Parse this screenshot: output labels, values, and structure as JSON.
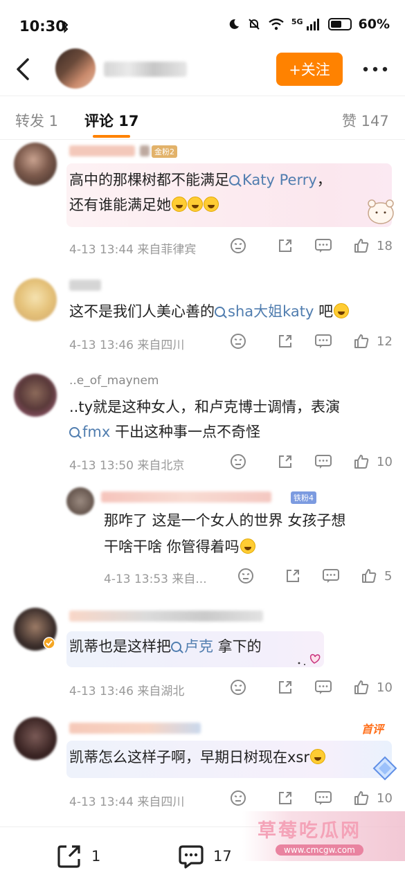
{
  "status": {
    "time": "10:30",
    "battery": "60%",
    "battery_level": 0.6,
    "signal": "5G"
  },
  "header": {
    "follow_label": "+关注"
  },
  "tabs": {
    "repost": "转发 1",
    "comment": "评论 17",
    "like": "赞 147"
  },
  "comments": [
    {
      "badge": "金粉2",
      "text_line1_before": "高中的那棵树都不能满足",
      "topic": "Katy Perry",
      "text_line1_after": "，",
      "text_line2": "还有谁能满足她",
      "meta": "4-13 13:44  来自菲律宾",
      "likes": "18"
    },
    {
      "text_before": "这不是我们人美心善的",
      "topic": "sha大姐katy",
      "text_after": " 吧",
      "meta": "4-13 13:46  来自四川",
      "likes": "12"
    },
    {
      "name_visible": "..e_of_maynem",
      "text_line1": "..ty就是这种女人，和卢克博士调情，表演",
      "topic": "fmx",
      "text_line2_after": " 干出这种事一点不奇怪",
      "meta": "4-13 13:50  来自北京",
      "likes": "10"
    },
    {
      "badge": "铁粉4",
      "text_line1": "那咋了 这是一个女人的世界 女孩子想",
      "text_line2": "干啥干啥 你管得着吗",
      "meta": "4-13 13:53  来自...",
      "likes": "5"
    },
    {
      "text_before": "凯蒂也是这样把",
      "topic": "卢克",
      "text_after": " 拿下的",
      "meta": "4-13 13:46  来自湖北",
      "likes": "10"
    },
    {
      "first_badge": "首评",
      "text": "凯蒂怎么这样子啊，早期日树现在xsr",
      "meta": "4-13 13:44  来自四川",
      "likes": "10"
    }
  ],
  "bottom": {
    "repost_count": "1",
    "comment_count": "17"
  },
  "watermark": {
    "title": "草莓吃瓜网",
    "url": "www.cmcgw.com"
  },
  "colors": {
    "accent": "#ff8200",
    "topic": "#507daf",
    "meta": "#999999"
  }
}
